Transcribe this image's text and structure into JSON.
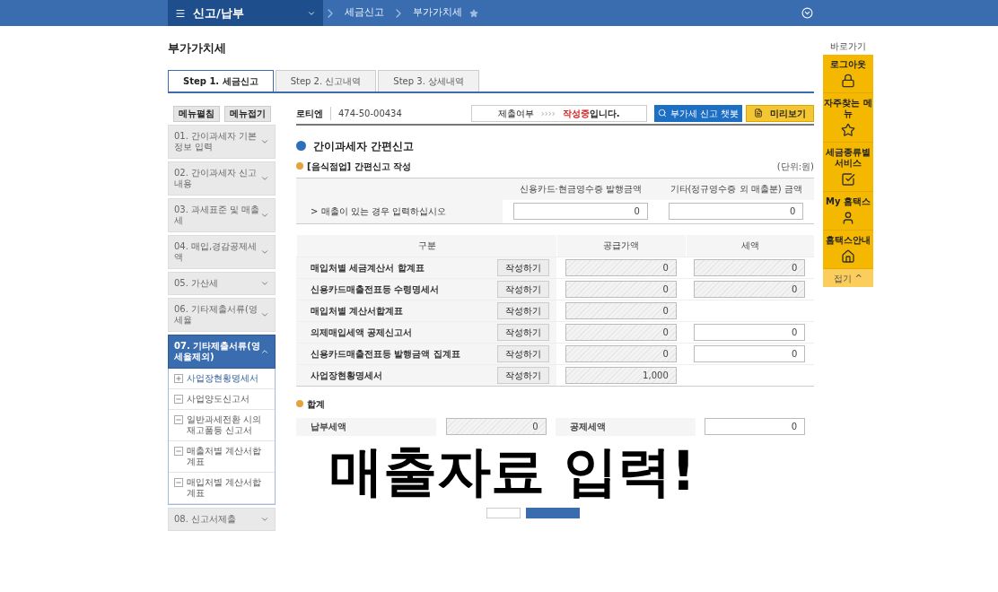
{
  "topbar": {
    "menu": "신고/납부",
    "crumbs": [
      {
        "label": "세금신고",
        "starred": false
      },
      {
        "label": "부가가치세",
        "starred": true
      }
    ]
  },
  "page_title": "부가가치세",
  "tabs": [
    {
      "label": "Step 1. 세금신고",
      "selected": true
    },
    {
      "label": "Step 2. 신고내역",
      "selected": false
    },
    {
      "label": "Step 3. 상세내역",
      "selected": false
    }
  ],
  "sidebar": {
    "buttons": [
      "메뉴펼침",
      "메뉴접기"
    ],
    "items": [
      {
        "label": "01. 간이과세자 기본정보 입력",
        "expanded": false,
        "selected": false
      },
      {
        "label": "02. 간이과세자 신고내용",
        "expanded": false,
        "selected": false
      },
      {
        "label": "03. 과세표준 및 매출세",
        "expanded": false,
        "selected": false
      },
      {
        "label": "04. 매입,경감공제세액",
        "expanded": false,
        "selected": false
      },
      {
        "label": "05. 가산세",
        "expanded": false,
        "selected": false
      },
      {
        "label": "06. 기타제출서류(영세율",
        "expanded": false,
        "selected": false
      },
      {
        "label": "07. 기타제출서류(영세율제외)",
        "expanded": true,
        "selected": true,
        "children": [
          {
            "label": "사업장현황명세서",
            "added": true
          },
          {
            "label": "사업양도신고서",
            "added": false
          },
          {
            "label": "일반과세전환 시의 재고품등 신고서",
            "added": false
          },
          {
            "label": "매출처별 계산서합계표",
            "added": false
          },
          {
            "label": "매입처별 계산서합계표",
            "added": false
          }
        ]
      },
      {
        "label": "08. 신고서제출",
        "expanded": false,
        "selected": false
      }
    ]
  },
  "info_bar": {
    "name": "로티엔",
    "business_number": "474-50-00434",
    "status_label": "제출여부",
    "status_arrows": "››››",
    "status_value": "작성중",
    "status_suffix": "입니다.",
    "chatbot_button": "부가세 신고 챗봇",
    "preview_button": "미리보기"
  },
  "section_title": "간이과세자 간편신고",
  "subsection_title": "[음식점업] 간편신고 작성",
  "unit": "(단위:원)",
  "sales_table": {
    "columns": [
      "신용카드·현금영수증 발행금액",
      "기타(정규영수증 외 매출분) 금액"
    ],
    "row_label": "> 매출이 있는 경우 입력하십시오",
    "values": [
      "0",
      "0"
    ]
  },
  "detail_table": {
    "columns": [
      "구분",
      "공급가액",
      "세액"
    ],
    "rows": [
      {
        "label": "매입처별 세금계산서 합계표",
        "button": "작성하기",
        "supply": "0",
        "tax": "0",
        "tax_editable": false
      },
      {
        "label": "신용카드매출전표등 수령명세서",
        "button": "작성하기",
        "supply": "0",
        "tax": "0",
        "tax_editable": false
      },
      {
        "label": "매입처별 계산서합계표",
        "button": "작성하기",
        "supply": "0"
      },
      {
        "label": "의제매입세액 공제신고서",
        "button": "작성하기",
        "supply": "0",
        "tax": "0",
        "tax_editable": true
      },
      {
        "label": "신용카드매출전표등 발행금액 집계표",
        "button": "작성하기",
        "supply": "0",
        "tax": "0",
        "tax_editable": true
      },
      {
        "label": "사업장현황명세서",
        "button": "작성하기",
        "supply": "1,000"
      }
    ]
  },
  "totals": {
    "title": "합계",
    "items": [
      {
        "label": "납부세액",
        "value": "0",
        "editable": false
      },
      {
        "label": "공제세액",
        "value": "0",
        "editable": true
      }
    ]
  },
  "quick_bar": {
    "title": "바로가기",
    "items": [
      "로그아웃",
      "자주찾는 메뉴",
      "세금종류별 서비스",
      "My 홈택스",
      "홈택스안내"
    ],
    "collapse": "접기 ^"
  },
  "caption": "매출자료 입력!"
}
